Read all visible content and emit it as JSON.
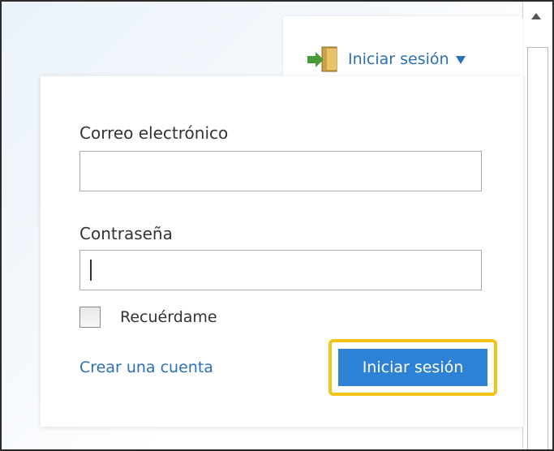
{
  "header": {
    "signin_tab_label": "Iniciar sesión",
    "signin_icon": "door-enter-icon"
  },
  "form": {
    "email_label": "Correo electrónico",
    "email_value": "",
    "password_label": "Contraseña",
    "password_value": "",
    "remember_label": "Recuérdame",
    "remember_checked": false,
    "create_account_link": "Crear una cuenta",
    "submit_label": "Iniciar sesión"
  },
  "colors": {
    "link": "#2a6fb8",
    "button": "#2e82d6",
    "highlight": "#f2c318"
  }
}
